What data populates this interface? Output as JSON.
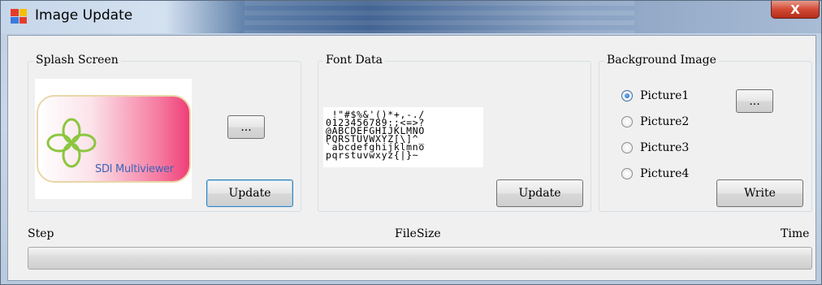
{
  "window": {
    "title": "Image Update",
    "close_label": "X"
  },
  "splash": {
    "group_label": "Splash Screen",
    "image_caption": "SDI Multiviewer",
    "browse_label": "...",
    "update_label": "Update"
  },
  "font_data": {
    "group_label": "Font Data",
    "glyph_rows": [
      " !\"#$%&'()*+,-./",
      "0123456789:;<=>?",
      "@ABCDEFGHIJKLMNO",
      "PQRSTUVWXYZ[\\]^_",
      "`abcdefghijklmno",
      "pqrstuvwxyz{|}~"
    ],
    "update_label": "Update"
  },
  "background": {
    "group_label": "Background Image",
    "options": [
      "Picture1",
      "Picture2",
      "Picture3",
      "Picture4"
    ],
    "selected": "Picture1",
    "browse_label": "...",
    "write_label": "Write"
  },
  "status": {
    "step_label": "Step",
    "filesize_label": "FileSize",
    "time_label": "Time",
    "progress": 0
  },
  "colors": {
    "accent": "#3c7fb1",
    "close": "#d34a35",
    "splash_pink": "#ee3f78",
    "splash_text": "#3d63b8"
  }
}
